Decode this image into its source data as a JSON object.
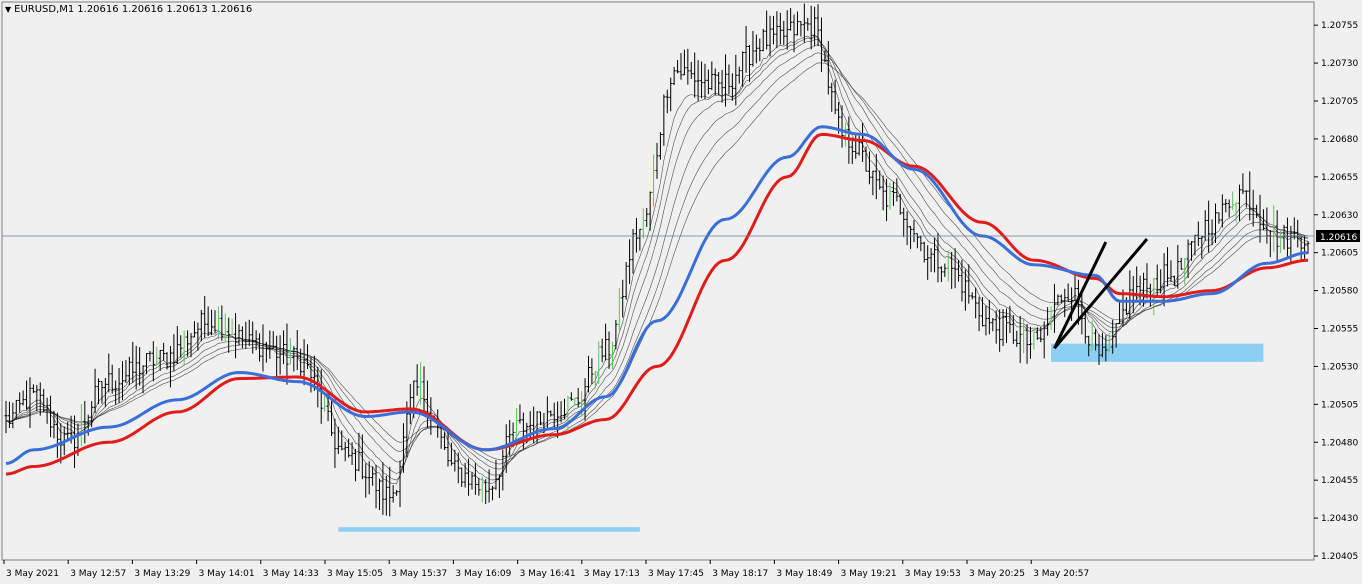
{
  "header": {
    "symbol": "EURUSD,M1",
    "ohlc": "1.20616 1.20616 1.20613 1.20616",
    "menu_icon": "triangle-down-icon"
  },
  "price_label": "1.20616",
  "colors": {
    "background": "#f0f0f0",
    "bars": "#000000",
    "bull_highlight": "#5fc35f",
    "ema_fast": "#3a6ed8",
    "ema_slow": "#e21b1b",
    "ribbon": "#1a1a1a",
    "zone": "#8ccff5",
    "price_line": "#6b7b8c",
    "price_tag_bg": "#000000"
  },
  "chart_data": {
    "type": "candlestick",
    "symbol": "EURUSD",
    "timeframe": "M1",
    "ylim": [
      1.20405,
      1.20765
    ],
    "y_ticks": [
      "1.20755",
      "1.20730",
      "1.20705",
      "1.20680",
      "1.20655",
      "1.20630",
      "1.20605",
      "1.20580",
      "1.20555",
      "1.20530",
      "1.20505",
      "1.20480",
      "1.20455",
      "1.20430",
      "1.20405"
    ],
    "x_ticks": [
      "3 May 2021",
      "3 May 12:57",
      "3 May 13:29",
      "3 May 14:01",
      "3 May 14:33",
      "3 May 15:05",
      "3 May 15:37",
      "3 May 16:09",
      "3 May 16:41",
      "3 May 17:13",
      "3 May 17:45",
      "3 May 18:17",
      "3 May 18:49",
      "3 May 19:21",
      "3 May 19:53",
      "3 May 20:25",
      "3 May 20:57"
    ],
    "current_price": 1.20616,
    "close_path": [
      {
        "i": 0,
        "p": 1.20495
      },
      {
        "i": 8,
        "p": 1.2051
      },
      {
        "i": 18,
        "p": 1.2048
      },
      {
        "i": 30,
        "p": 1.2052
      },
      {
        "i": 45,
        "p": 1.20535
      },
      {
        "i": 60,
        "p": 1.2056
      },
      {
        "i": 72,
        "p": 1.20545
      },
      {
        "i": 85,
        "p": 1.20535
      },
      {
        "i": 100,
        "p": 1.2047
      },
      {
        "i": 112,
        "p": 1.20445
      },
      {
        "i": 120,
        "p": 1.20515
      },
      {
        "i": 132,
        "p": 1.2046
      },
      {
        "i": 140,
        "p": 1.2045
      },
      {
        "i": 150,
        "p": 1.2049
      },
      {
        "i": 165,
        "p": 1.20505
      },
      {
        "i": 175,
        "p": 1.2054
      },
      {
        "i": 185,
        "p": 1.2062
      },
      {
        "i": 195,
        "p": 1.20725
      },
      {
        "i": 208,
        "p": 1.20715
      },
      {
        "i": 222,
        "p": 1.20745
      },
      {
        "i": 235,
        "p": 1.20755
      },
      {
        "i": 245,
        "p": 1.2068
      },
      {
        "i": 258,
        "p": 1.2064
      },
      {
        "i": 272,
        "p": 1.206
      },
      {
        "i": 290,
        "p": 1.20555
      },
      {
        "i": 300,
        "p": 1.20545
      },
      {
        "i": 310,
        "p": 1.2058
      },
      {
        "i": 320,
        "p": 1.20535
      },
      {
        "i": 330,
        "p": 1.2058
      },
      {
        "i": 340,
        "p": 1.2059
      },
      {
        "i": 352,
        "p": 1.20625
      },
      {
        "i": 360,
        "p": 1.20645
      },
      {
        "i": 372,
        "p": 1.20615
      },
      {
        "i": 380,
        "p": 1.20616
      }
    ],
    "ema_fast_path": [
      {
        "i": 0,
        "p": 1.20466
      },
      {
        "i": 8,
        "p": 1.20475
      },
      {
        "i": 30,
        "p": 1.2049
      },
      {
        "i": 50,
        "p": 1.20508
      },
      {
        "i": 68,
        "p": 1.20526
      },
      {
        "i": 85,
        "p": 1.2052
      },
      {
        "i": 105,
        "p": 1.20497
      },
      {
        "i": 118,
        "p": 1.205
      },
      {
        "i": 140,
        "p": 1.20475
      },
      {
        "i": 160,
        "p": 1.20489
      },
      {
        "i": 175,
        "p": 1.2051
      },
      {
        "i": 190,
        "p": 1.2056
      },
      {
        "i": 210,
        "p": 1.20627
      },
      {
        "i": 228,
        "p": 1.20668
      },
      {
        "i": 238,
        "p": 1.20688
      },
      {
        "i": 250,
        "p": 1.20683
      },
      {
        "i": 265,
        "p": 1.2066
      },
      {
        "i": 285,
        "p": 1.20616
      },
      {
        "i": 300,
        "p": 1.20597
      },
      {
        "i": 318,
        "p": 1.2059
      },
      {
        "i": 325,
        "p": 1.20573
      },
      {
        "i": 338,
        "p": 1.20573
      },
      {
        "i": 352,
        "p": 1.20578
      },
      {
        "i": 368,
        "p": 1.20598
      },
      {
        "i": 380,
        "p": 1.20605
      }
    ],
    "ema_slow_path": [
      {
        "i": 0,
        "p": 1.20459
      },
      {
        "i": 8,
        "p": 1.20464
      },
      {
        "i": 30,
        "p": 1.2048
      },
      {
        "i": 50,
        "p": 1.205
      },
      {
        "i": 68,
        "p": 1.20522
      },
      {
        "i": 85,
        "p": 1.20523
      },
      {
        "i": 105,
        "p": 1.205
      },
      {
        "i": 118,
        "p": 1.20502
      },
      {
        "i": 140,
        "p": 1.20475
      },
      {
        "i": 160,
        "p": 1.20485
      },
      {
        "i": 175,
        "p": 1.20495
      },
      {
        "i": 190,
        "p": 1.2053
      },
      {
        "i": 210,
        "p": 1.206
      },
      {
        "i": 228,
        "p": 1.20655
      },
      {
        "i": 238,
        "p": 1.20683
      },
      {
        "i": 250,
        "p": 1.20679
      },
      {
        "i": 265,
        "p": 1.20662
      },
      {
        "i": 285,
        "p": 1.20625
      },
      {
        "i": 300,
        "p": 1.206
      },
      {
        "i": 318,
        "p": 1.20588
      },
      {
        "i": 325,
        "p": 1.20578
      },
      {
        "i": 338,
        "p": 1.20576
      },
      {
        "i": 352,
        "p": 1.2058
      },
      {
        "i": 368,
        "p": 1.20595
      },
      {
        "i": 380,
        "p": 1.206
      }
    ],
    "support_zones": [
      {
        "from_i": 97,
        "to_i": 185,
        "low": 1.20421,
        "high": 1.20424
      },
      {
        "from_i": 305,
        "to_i": 367,
        "low": 1.20533,
        "high": 1.20545
      }
    ],
    "trend_lines": [
      {
        "from_i": 306,
        "from_p": 1.20542,
        "to_i": 321,
        "to_p": 1.20612
      },
      {
        "from_i": 306,
        "from_p": 1.20542,
        "to_i": 333,
        "to_p": 1.20614
      }
    ]
  }
}
